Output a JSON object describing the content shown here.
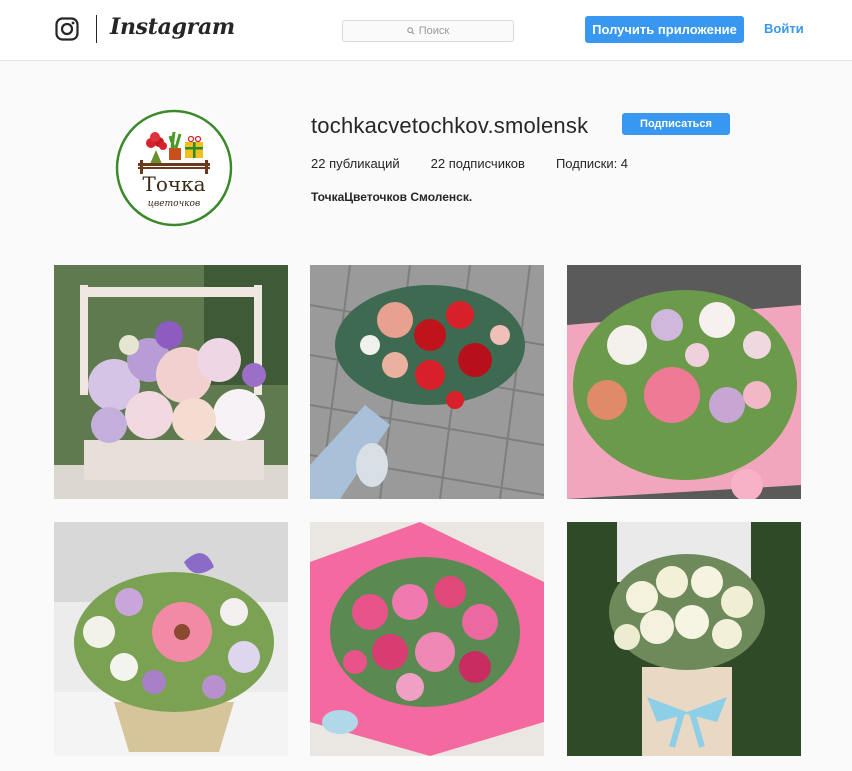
{
  "header": {
    "brand": "Instagram",
    "search_placeholder": "Поиск",
    "get_app_label": "Получить приложение",
    "login_label": "Войти"
  },
  "profile": {
    "username": "tochkacvetochkov.smolensk",
    "follow_label": "Подписаться",
    "stats": {
      "posts": "22 публикаций",
      "followers": "22 подписчиков",
      "following": "Подписки: 4"
    },
    "full_name": "ТочкаЦветочков Смоленск.",
    "logo": {
      "title": "Точка",
      "subtitle": "цветочков"
    }
  },
  "posts": [
    {
      "subject": "flower box with dahlias and roses"
    },
    {
      "subject": "bouquet with red roses in hand"
    },
    {
      "subject": "pink bouquet with carnation"
    },
    {
      "subject": "basket with gerbera"
    },
    {
      "subject": "pink chrysanthemum bouquet"
    },
    {
      "subject": "white roses in hatbox"
    }
  ],
  "colors": {
    "accent": "#3897f0",
    "background": "#fafafa",
    "text": "#262626"
  }
}
